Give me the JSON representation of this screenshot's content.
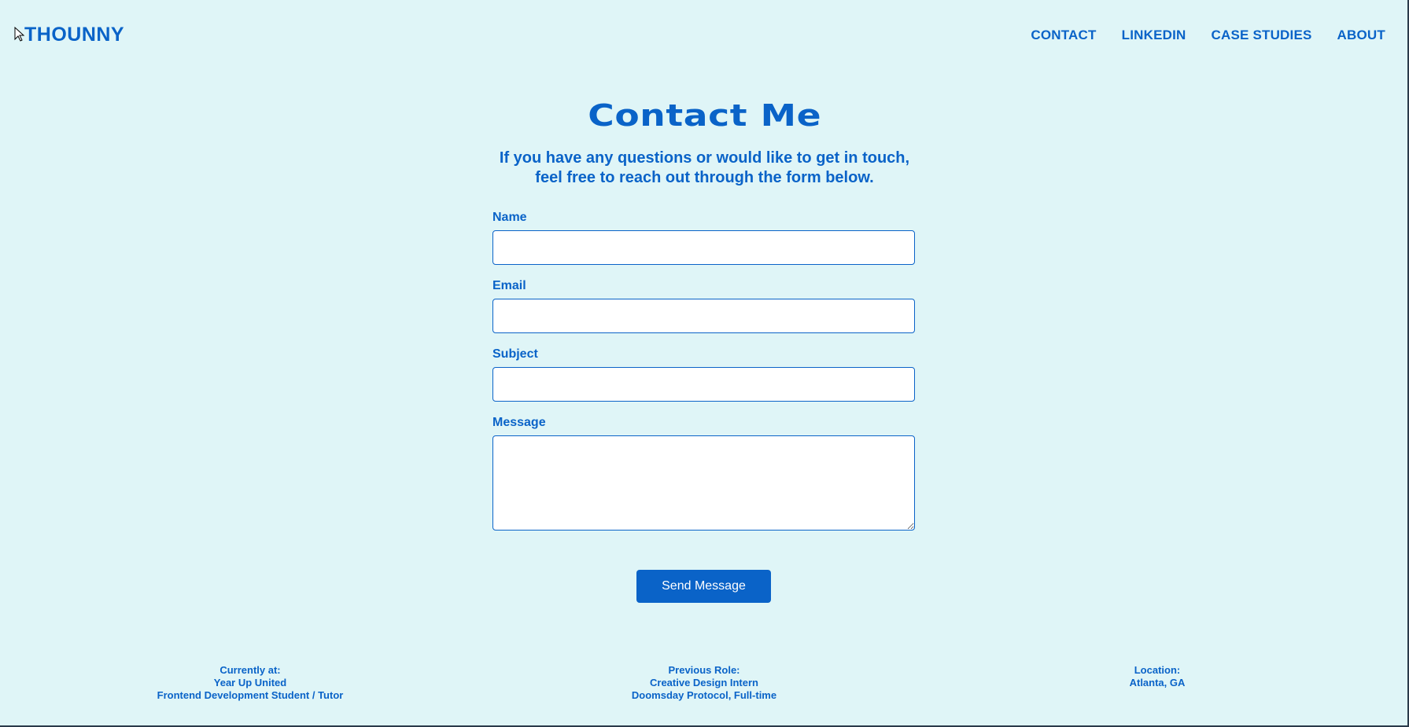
{
  "header": {
    "logo": "THOUNNY",
    "nav": [
      "CONTACT",
      "LINKEDIN",
      "CASE STUDIES",
      "ABOUT"
    ]
  },
  "main": {
    "title": "Contact Me",
    "subtitle": "If you have any questions or would like to get in touch, feel free to reach out through the form below."
  },
  "form": {
    "name_label": "Name",
    "name_value": "",
    "email_label": "Email",
    "email_value": "",
    "subject_label": "Subject",
    "subject_value": "",
    "message_label": "Message",
    "message_value": "",
    "submit_label": "Send Message"
  },
  "footer": {
    "current": {
      "heading": "Currently at:",
      "org": "Year Up United",
      "role": "Frontend Development Student / Tutor"
    },
    "previous": {
      "heading": "Previous Role:",
      "role": "Creative Design Intern",
      "org": "Doomsday Protocol, Full-time"
    },
    "location": {
      "heading": "Location:",
      "value": "Atlanta, GA"
    }
  },
  "colors": {
    "background": "#dff5f7",
    "accent": "#0a63c8",
    "field_background": "#ffffff"
  }
}
